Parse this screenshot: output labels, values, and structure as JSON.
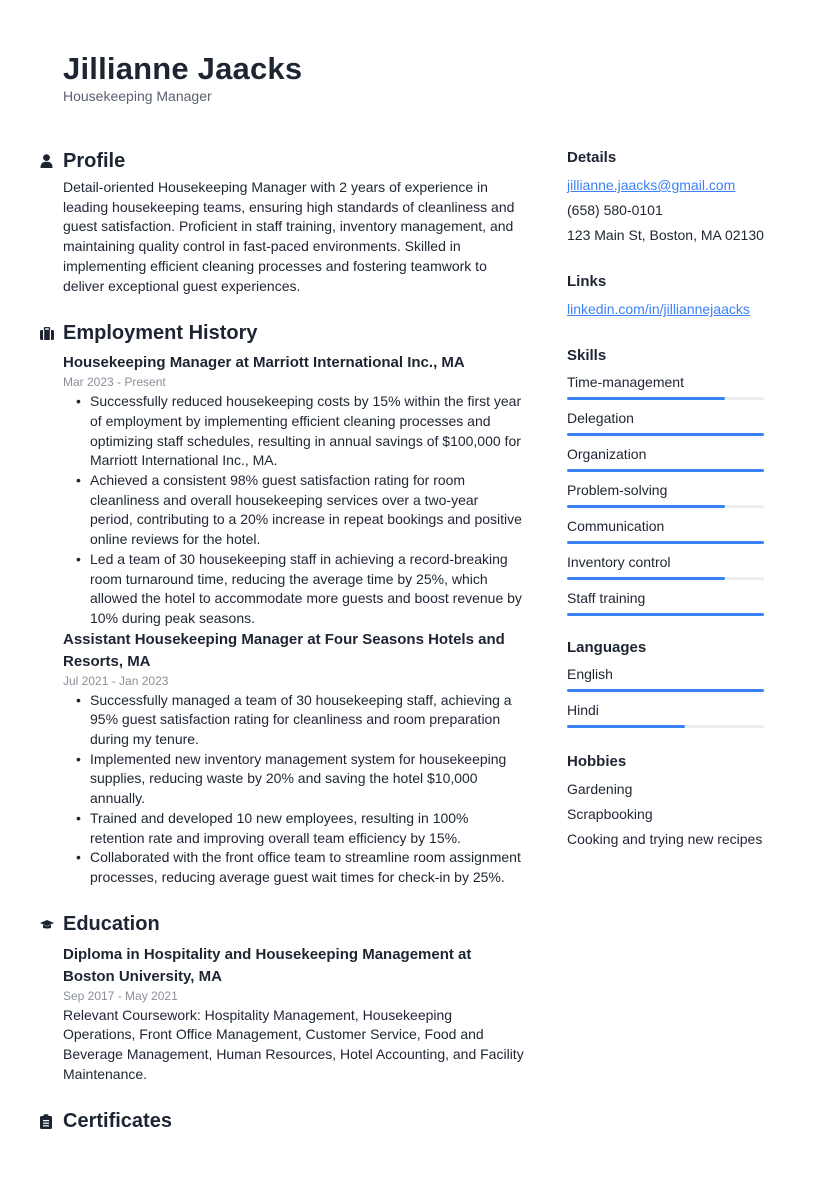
{
  "header": {
    "name": "Jillianne Jaacks",
    "title": "Housekeeping Manager"
  },
  "profile": {
    "title": "Profile",
    "icon": "user-icon",
    "text": "Detail-oriented Housekeeping Manager with 2 years of experience in leading housekeeping teams, ensuring high standards of cleanliness and guest satisfaction. Proficient in staff training, inventory management, and maintaining quality control in fast-paced environments. Skilled in implementing efficient cleaning processes and fostering teamwork to deliver exceptional guest experiences."
  },
  "employment": {
    "title": "Employment History",
    "icon": "briefcase-icon",
    "jobs": [
      {
        "heading": "Housekeeping Manager at Marriott International Inc., MA",
        "dates": "Mar 2023 - Present",
        "bullets": [
          "Successfully reduced housekeeping costs by 15% within the first year of employment by implementing efficient cleaning processes and optimizing staff schedules, resulting in annual savings of $100,000 for Marriott International Inc., MA.",
          "Achieved a consistent 98% guest satisfaction rating for room cleanliness and overall housekeeping services over a two-year period, contributing to a 20% increase in repeat bookings and positive online reviews for the hotel.",
          "Led a team of 30 housekeeping staff in achieving a record-breaking room turnaround time, reducing the average time by 25%, which allowed the hotel to accommodate more guests and boost revenue by 10% during peak seasons."
        ]
      },
      {
        "heading": "Assistant Housekeeping Manager at Four Seasons Hotels and Resorts, MA",
        "dates": "Jul 2021 - Jan 2023",
        "bullets": [
          "Successfully managed a team of 30 housekeeping staff, achieving a 95% guest satisfaction rating for cleanliness and room preparation during my tenure.",
          "Implemented new inventory management system for housekeeping supplies, reducing waste by 20% and saving the hotel $10,000 annually.",
          "Trained and developed 10 new employees, resulting in 100% retention rate and improving overall team efficiency by 15%.",
          "Collaborated with the front office team to streamline room assignment processes, reducing average guest wait times for check-in by 25%."
        ]
      }
    ]
  },
  "education": {
    "title": "Education",
    "icon": "graduation-cap-icon",
    "entries": [
      {
        "heading": "Diploma in Hospitality and Housekeeping Management at Boston University, MA",
        "dates": "Sep 2017 - May 2021",
        "text": "Relevant Coursework: Hospitality Management, Housekeeping Operations, Front Office Management, Customer Service, Food and Beverage Management, Human Resources, Hotel Accounting, and Facility Maintenance."
      }
    ]
  },
  "certificates": {
    "title": "Certificates",
    "icon": "clipboard-icon"
  },
  "details": {
    "title": "Details",
    "email": "jillianne.jaacks@gmail.com",
    "phone": "(658) 580-0101",
    "address": "123 Main St, Boston, MA 02130"
  },
  "links": {
    "title": "Links",
    "items": [
      "linkedin.com/in/jilliannejaacks"
    ]
  },
  "skills": {
    "title": "Skills",
    "items": [
      {
        "name": "Time-management",
        "level": 0.8
      },
      {
        "name": "Delegation",
        "level": 1.0
      },
      {
        "name": "Organization",
        "level": 1.0
      },
      {
        "name": "Problem-solving",
        "level": 0.8
      },
      {
        "name": "Communication",
        "level": 1.0
      },
      {
        "name": "Inventory control",
        "level": 0.8
      },
      {
        "name": "Staff training",
        "level": 1.0
      }
    ]
  },
  "languages": {
    "title": "Languages",
    "items": [
      {
        "name": "English",
        "level": 1.0
      },
      {
        "name": "Hindi",
        "level": 0.6
      }
    ]
  },
  "hobbies": {
    "title": "Hobbies",
    "items": [
      "Gardening",
      "Scrapbooking",
      "Cooking and trying new recipes"
    ]
  },
  "colors": {
    "accent": "#3b82f6",
    "text": "#1e2532",
    "muted": "#8a8f99"
  }
}
